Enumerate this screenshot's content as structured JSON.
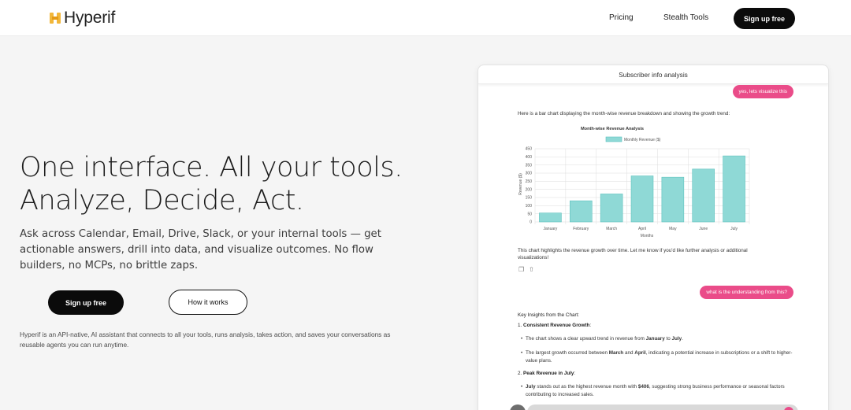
{
  "header": {
    "logo_text": "Hyperif",
    "logo_icon": "hyperif-logo-icon",
    "nav": [
      "Pricing",
      "Stealth Tools"
    ],
    "cta_label": "Sign up free"
  },
  "hero": {
    "headline_line1": "One interface. All your tools.",
    "headline_line2": "Analyze, Decide, Act.",
    "subheading": "Ask across Calendar, Email, Drive, Slack, or your internal tools — get actionable answers, drill into data, and visualize outcomes. No flow builders, no MCPs, no brittle zaps.",
    "primary_label": "Sign up free",
    "secondary_label": "How it works",
    "description": "Hyperif is an API-native, AI assistant that connects to all your tools, runs analysis, takes action, and saves your conversations as reusable agents you can run anytime."
  },
  "chat": {
    "title": "Subscriber info analysis",
    "user_msg_1": "yes, lets visualize this",
    "assistant_intro": "Here is a bar chart displaying the month-wise revenue breakdown and showing the growth trend:",
    "assistant_after_line1": "This chart highlights the revenue growth over time. Let me know if you'd like further analysis or additional",
    "assistant_after_line2": "visualizations!",
    "icons": [
      "copy-icon",
      "share-icon"
    ],
    "user_msg_2": "what is the understanding from this?",
    "insights_title": "Key Insights from the Chart:",
    "insight_1_num": "1.",
    "insight_1_title": "Consistent Revenue Growth",
    "insight_1_suffix": ":",
    "insight_1_b1_pre": "The chart shows a clear upward trend in revenue from ",
    "insight_1_b1_m1": "January",
    "insight_1_b1_mid": " to ",
    "insight_1_b1_m2": "July",
    "insight_1_b1_end": ".",
    "insight_1_b2_pre": "The largest growth occurred between ",
    "insight_1_b2_m1": "March",
    "insight_1_b2_mid": " and ",
    "insight_1_b2_m2": "April",
    "insight_1_b2_end": ", indicating a potential increase in subscriptions or a shift to higher-value plans.",
    "insight_2_num": "2.",
    "insight_2_title": "Peak Revenue in July",
    "insight_2_suffix": ":",
    "insight_2_b1_m": "July",
    "insight_2_b1_mid": " stands out as the highest revenue month with ",
    "insight_2_b1_val": "$406",
    "insight_2_b1_end": ", suggesting strong business performance or seasonal factors contributing to increased sales."
  },
  "colors": {
    "accent_pink": "#ea4c89",
    "bar_fill": "#8fd9d6",
    "bar_stroke": "#5fc2be",
    "button_black": "#0b0b0b"
  },
  "chart_data": {
    "type": "bar",
    "title": "Month-wise Revenue Analysis",
    "legend": "Monthly Revenue ($)",
    "xlabel": "Months",
    "ylabel": "Revenue ($)",
    "categories": [
      "January",
      "February",
      "March",
      "April",
      "May",
      "June",
      "July"
    ],
    "values": [
      55,
      130,
      172,
      283,
      275,
      325,
      406
    ],
    "ylim": [
      0,
      450
    ],
    "yticks": [
      0,
      50,
      100,
      150,
      200,
      250,
      300,
      350,
      400,
      450
    ],
    "grid": true,
    "legend_position": "top"
  }
}
